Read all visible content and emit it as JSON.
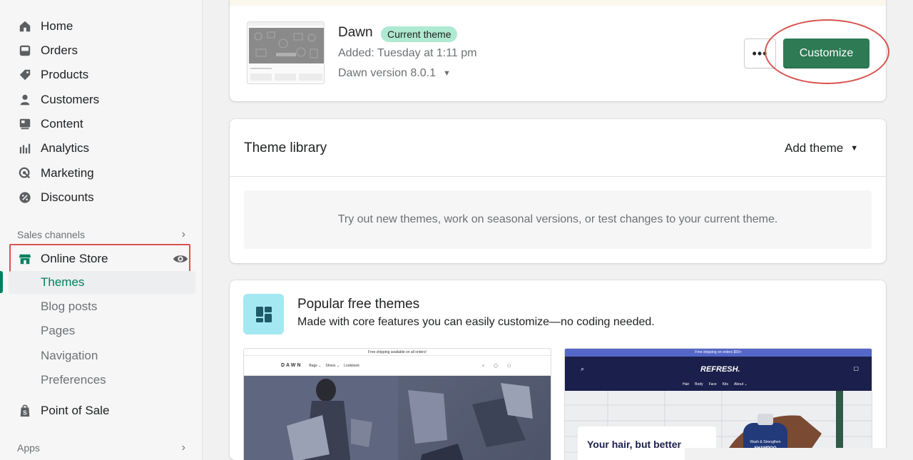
{
  "sidebar": {
    "items": [
      {
        "label": "Home",
        "icon": "home-icon"
      },
      {
        "label": "Orders",
        "icon": "orders-icon"
      },
      {
        "label": "Products",
        "icon": "tag-icon"
      },
      {
        "label": "Customers",
        "icon": "person-icon"
      },
      {
        "label": "Content",
        "icon": "content-icon"
      },
      {
        "label": "Analytics",
        "icon": "analytics-icon"
      },
      {
        "label": "Marketing",
        "icon": "marketing-icon"
      },
      {
        "label": "Discounts",
        "icon": "discount-icon"
      }
    ],
    "sales_channels_label": "Sales channels",
    "online_store_label": "Online Store",
    "sub_items": [
      "Themes",
      "Blog posts",
      "Pages",
      "Navigation",
      "Preferences"
    ],
    "pos_label": "Point of Sale",
    "apps_label": "Apps"
  },
  "current_theme": {
    "name": "Dawn",
    "badge": "Current theme",
    "added": "Added: Tuesday at 1:11 pm",
    "version": "Dawn version 8.0.1",
    "more_label": "•••",
    "customize_label": "Customize"
  },
  "library": {
    "title": "Theme library",
    "add_theme_label": "Add theme",
    "empty_text": "Try out new themes, work on seasonal versions, or test changes to your current theme."
  },
  "popular": {
    "title": "Popular free themes",
    "subtitle": "Made with core features you can easily customize—no coding needed.",
    "dawn": {
      "banner": "Free shipping available on all orders!",
      "logo": "DAWN",
      "nav": [
        "Bags ⌄",
        "Shoes ⌄",
        "Lookbook"
      ]
    },
    "refresh": {
      "banner": "Free shipping on orders $50+",
      "logo": "REFRESH.",
      "nav": [
        "Hair",
        "Body",
        "Face",
        "Kits",
        "About ⌄"
      ],
      "headline": "Your hair, but better",
      "product_text": "Wash & Strengthen",
      "product_name": "SHAMPOO"
    }
  },
  "colors": {
    "accent": "#2d7a55",
    "active_nav": "#007f5f",
    "badge_bg": "#aee9d1",
    "annotation_red": "#d9534f"
  }
}
